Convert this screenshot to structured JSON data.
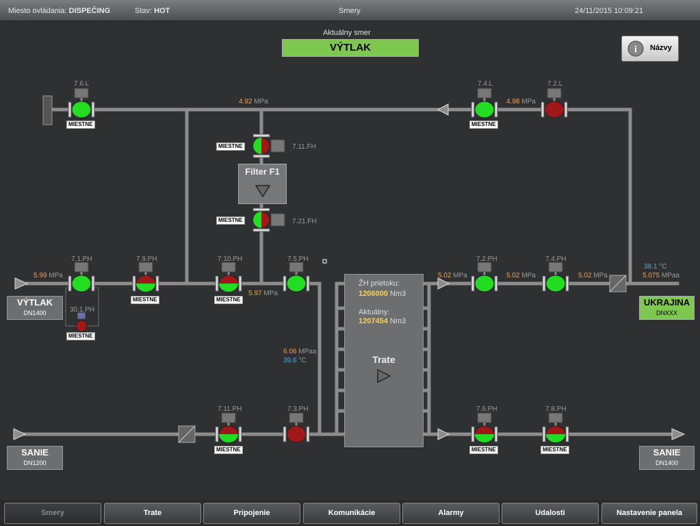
{
  "topbar": {
    "location_label": "Miesto ovládania:",
    "location_value": "DISPEČING",
    "state_label": "Stav:",
    "state_value": "HOT",
    "screen_title": "Smery",
    "datetime": "24/11/2015 10:09:21"
  },
  "direction": {
    "label": "Aktuálny smer",
    "value": "VÝTLAK"
  },
  "names_button": "Názvy",
  "filter": {
    "title": "Filter F1"
  },
  "trate": {
    "flow_label": "ŽH prietoku:",
    "flow_value": "1206000",
    "flow_unit": "Nm3",
    "current_label": "Aktuálny:",
    "current_value": "1207454",
    "current_unit": "Nm3",
    "title": "Trate"
  },
  "valves": {
    "v76l": "7.6.L",
    "v74l": "7.4.L",
    "v72l": "7.2.L",
    "v711fh": "7.11.FH",
    "v721fh": "7.21.FH",
    "v71ph": "7.1.PH",
    "v79ph": "7.9.PH",
    "v710ph": "7.10.PH",
    "v75ph": "7.5.PH",
    "v72ph": "7.2.PH",
    "v74ph": "7.4.PH",
    "v301ph": "30.1.PH",
    "v711ph": "7.11.PH",
    "v73ph": "7.3.PH",
    "v76ph": "7.6.PH",
    "v78ph": "7.8.PH"
  },
  "miestne": "MIESTNE",
  "pressures": {
    "p1": "4.92",
    "p2": "4.98",
    "p3": "5.99",
    "p4": "5.97",
    "p5": "5.02",
    "p6": "5.02",
    "p7": "5.02",
    "p8": "6.06",
    "p9": "5.075"
  },
  "temps": {
    "t1": "39.6",
    "t2": "38.1"
  },
  "units": {
    "mpa": "MPa",
    "mpaa": "MPaa",
    "degc": "°C"
  },
  "ends": {
    "vytlak": {
      "name": "VÝTLAK",
      "dn": "DN1400"
    },
    "ukrajina": {
      "name": "UKRAJINA",
      "dn": "DNXXX"
    },
    "sanie_left": {
      "name": "SANIE",
      "dn": "DN1200"
    },
    "sanie_right": {
      "name": "SANIE",
      "dn": "DN1400"
    }
  },
  "nav": [
    "Smery",
    "Trate",
    "Pripojenie",
    "Komunikácie",
    "Alarmy",
    "Udalosti",
    "Nastavenie panela"
  ],
  "colors": {
    "valve_open": "#22dd22",
    "valve_closed": "#a01818",
    "pipe": "#8d8d8d"
  }
}
